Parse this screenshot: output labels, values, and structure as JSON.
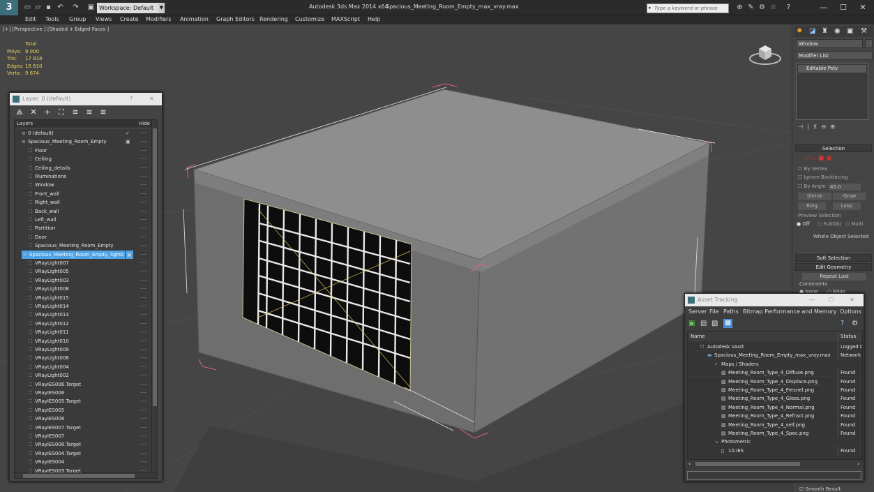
{
  "app": {
    "logo": "3",
    "workspace": "Workspace: Default",
    "title": "Autodesk 3ds Max  2014 x64",
    "file": "Spacious_Meeting_Room_Empty_max_vray.max",
    "search_placeholder": "Type a keyword or phrase",
    "search_icon": "play-icon",
    "minimize": "—",
    "maximize": "☐",
    "close": "✕"
  },
  "menu": [
    "Edit",
    "Tools",
    "Group",
    "Views",
    "Create",
    "Modifiers",
    "Animation",
    "Graph Editors",
    "Rendering",
    "Customize",
    "MAXScript",
    "Help"
  ],
  "viewport": {
    "label": "[+] [Perspective ] [Shaded + Edged Faces ]",
    "stats": {
      "header": "Total",
      "polys_label": "Polys:",
      "polys": "9 000",
      "tris_label": "Tris:",
      "tris": "17 818",
      "edges_label": "Edges:",
      "edges": "18 610",
      "verts_label": "Verts:",
      "verts": "9 674"
    },
    "colors": {
      "background": "#454545",
      "box_top": "#8e8e8e",
      "box_left": "#6e6e6e",
      "box_right": "#727272",
      "selection": "#e0608a"
    }
  },
  "command_panel": {
    "object_name": "Window",
    "modifier_list": "Modifier List",
    "stack_item": "Editable Poly",
    "selection_header": "Selection",
    "by_vertex": "By Vertex",
    "ignore_backfacing": "Ignore Backfacing",
    "by_angle": "By Angle:",
    "angle_value": "45.0",
    "shrink": "Shrink",
    "grow": "Grow",
    "ring": "Ring",
    "loop": "Loop",
    "preview_selection": "Preview Selection",
    "off": "Off",
    "subobj": "SubObj",
    "multi": "Multi",
    "whole_object": "Whole Object Selected",
    "soft_selection": "Soft Selection",
    "edit_geometry": "Edit Geometry",
    "repeat_last": "Repeat Last",
    "constraints": "Constraints",
    "none": "None",
    "edge": "Edge",
    "smooth_result": "Smooth Result"
  },
  "layer_window": {
    "title": "Layer: 0 (default)",
    "help": "?",
    "close": "✕",
    "col_layers": "Layers",
    "col_hide": "Hide",
    "rows": [
      {
        "name": "0 (default)",
        "indent": 0,
        "type": "layer",
        "check": "✓"
      },
      {
        "name": "Spacious_Meeting_Room_Empty",
        "indent": 0,
        "type": "layer",
        "check": "▣"
      },
      {
        "name": "Floor",
        "indent": 1
      },
      {
        "name": "Ceiling",
        "indent": 1
      },
      {
        "name": "Ceiling_details",
        "indent": 1
      },
      {
        "name": "Illuminations",
        "indent": 1
      },
      {
        "name": "Window",
        "indent": 1
      },
      {
        "name": "Front_wall",
        "indent": 1
      },
      {
        "name": "Right_wall",
        "indent": 1
      },
      {
        "name": "Back_wall",
        "indent": 1
      },
      {
        "name": "Left_wall",
        "indent": 1
      },
      {
        "name": "Partition",
        "indent": 1
      },
      {
        "name": "Door",
        "indent": 1
      },
      {
        "name": "Spacious_Meeting_Room_Empty",
        "indent": 1
      },
      {
        "name": "Spacious_Meeting_Room_Empty_lights",
        "indent": 0,
        "type": "layer",
        "selected": true,
        "check": "▣"
      },
      {
        "name": "VRayLight007",
        "indent": 1
      },
      {
        "name": "VRayLight005",
        "indent": 1
      },
      {
        "name": "VRayLight003",
        "indent": 1
      },
      {
        "name": "VRayLight008",
        "indent": 1
      },
      {
        "name": "VRayLight015",
        "indent": 1
      },
      {
        "name": "VRayLight014",
        "indent": 1
      },
      {
        "name": "VRayLight013",
        "indent": 1
      },
      {
        "name": "VRayLight012",
        "indent": 1
      },
      {
        "name": "VRayLight011",
        "indent": 1
      },
      {
        "name": "VRayLight010",
        "indent": 1
      },
      {
        "name": "VRayLight009",
        "indent": 1
      },
      {
        "name": "VRayLight006",
        "indent": 1
      },
      {
        "name": "VRayLight004",
        "indent": 1
      },
      {
        "name": "VRayLight002",
        "indent": 1
      },
      {
        "name": "VRayIES006.Target",
        "indent": 1
      },
      {
        "name": "VRayIES006",
        "indent": 1
      },
      {
        "name": "VRayIES005.Target",
        "indent": 1
      },
      {
        "name": "VRayIES005",
        "indent": 1
      },
      {
        "name": "VRayIES008",
        "indent": 1
      },
      {
        "name": "VRayIES007.Target",
        "indent": 1
      },
      {
        "name": "VRayIES007",
        "indent": 1
      },
      {
        "name": "VRayIES008.Target",
        "indent": 1
      },
      {
        "name": "VRayIES004.Target",
        "indent": 1
      },
      {
        "name": "VRayIES004",
        "indent": 1
      },
      {
        "name": "VRayIES003.Target",
        "indent": 1
      }
    ]
  },
  "asset_window": {
    "title": "Asset Tracking",
    "minimize": "—",
    "maximize": "☐",
    "close": "✕",
    "menu": [
      "Server",
      "File",
      "Paths",
      "Bitmap Performance and Memory",
      "Options"
    ],
    "col_name": "Name",
    "col_status": "Status",
    "rows": [
      {
        "name": "Autodesk Vault",
        "status": "Logged O",
        "indent": 1,
        "icon": "vault-icon"
      },
      {
        "name": "Spacious_Meeting_Room_Empty_max_vray.max",
        "status": "Network P",
        "indent": 2,
        "icon": "max-file-icon"
      },
      {
        "name": "Maps / Shaders",
        "status": "",
        "indent": 3,
        "icon": "maps-icon"
      },
      {
        "name": "Meeting_Room_Type_4_Diffuse.png",
        "status": "Found",
        "indent": 4,
        "icon": "image-file-icon"
      },
      {
        "name": "Meeting_Room_Type_4_Displace.png",
        "status": "Found",
        "indent": 4,
        "icon": "image-file-icon"
      },
      {
        "name": "Meeting_Room_Type_4_Fresnel.png",
        "status": "Found",
        "indent": 4,
        "icon": "image-file-icon"
      },
      {
        "name": "Meeting_Room_Type_4_Gloss.png",
        "status": "Found",
        "indent": 4,
        "icon": "image-file-icon"
      },
      {
        "name": "Meeting_Room_Type_4_Normal.png",
        "status": "Found",
        "indent": 4,
        "icon": "image-file-icon"
      },
      {
        "name": "Meeting_Room_Type_4_Refract.png",
        "status": "Found",
        "indent": 4,
        "icon": "image-file-icon"
      },
      {
        "name": "Meeting_Room_Type_4_self.png",
        "status": "Found",
        "indent": 4,
        "icon": "image-file-icon"
      },
      {
        "name": "Meeting_Room_Type_4_Spec.png",
        "status": "Found",
        "indent": 4,
        "icon": "image-file-icon"
      },
      {
        "name": "Photometric",
        "status": "",
        "indent": 3,
        "icon": "photometric-icon"
      },
      {
        "name": "10.IES",
        "status": "Found",
        "indent": 4,
        "icon": "ies-file-icon"
      }
    ]
  }
}
